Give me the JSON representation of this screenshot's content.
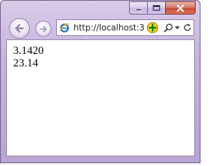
{
  "window": {
    "caption_buttons": [
      "minimize-icon",
      "maximize-icon",
      "close-icon"
    ],
    "accent_color": "#c7b3dd"
  },
  "toolbar": {
    "back_icon": "back-arrow-icon",
    "forward_icon": "forward-arrow-icon",
    "address": {
      "url": "http://localhost:3",
      "site_icon": "ie-icon",
      "compat_icon": "compatibility-view-icon",
      "search_icon": "search-icon",
      "dropdown_icon": "chevron-down-icon",
      "refresh_icon": "refresh-icon"
    }
  },
  "page": {
    "lines": [
      "3.1420",
      "23.14"
    ]
  }
}
